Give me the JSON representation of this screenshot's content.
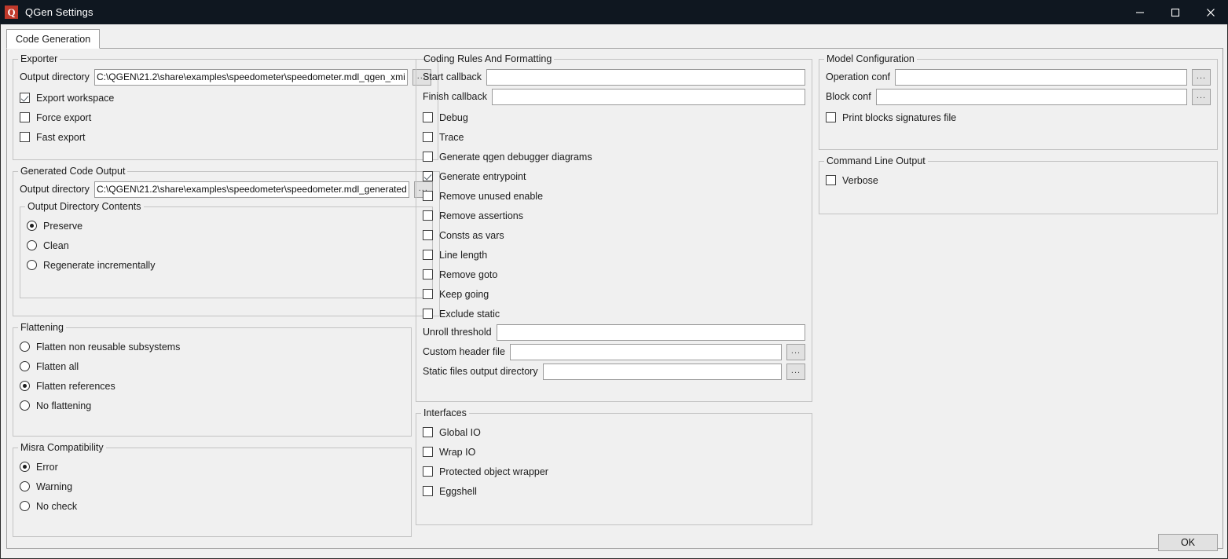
{
  "window": {
    "title": "QGen Settings",
    "logo_letter": "Q",
    "logo_color": "#c0392b",
    "titlebar_color": "#0f1720",
    "minimize_icon": "minimize-icon",
    "maximize_icon": "maximize-icon",
    "close_icon": "close-icon"
  },
  "tabs": [
    {
      "label": "Code Generation",
      "selected": true
    }
  ],
  "groups": {
    "exporter": {
      "title": "Exporter",
      "output_directory_label": "Output directory",
      "output_directory_value": "C:\\QGEN\\21.2\\share\\examples\\speedometer\\speedometer.mdl_qgen_xmi",
      "browse_label": "...",
      "checkboxes": [
        {
          "label": "Export workspace",
          "checked": true
        },
        {
          "label": "Force export",
          "checked": false
        },
        {
          "label": "Fast export",
          "checked": false
        }
      ]
    },
    "generated_code_output": {
      "title": "Generated Code Output",
      "output_directory_label": "Output directory",
      "output_directory_value": "C:\\QGEN\\21.2\\share\\examples\\speedometer\\speedometer.mdl_generated",
      "browse_label": "...",
      "output_directory_contents": {
        "title": "Output Directory Contents",
        "options": [
          {
            "label": "Preserve",
            "checked": true
          },
          {
            "label": "Clean",
            "checked": false
          },
          {
            "label": "Regenerate incrementally",
            "checked": false
          }
        ]
      }
    },
    "flattening": {
      "title": "Flattening",
      "options": [
        {
          "label": "Flatten non reusable subsystems",
          "checked": false
        },
        {
          "label": "Flatten all",
          "checked": false
        },
        {
          "label": "Flatten references",
          "checked": true
        },
        {
          "label": "No flattening",
          "checked": false
        }
      ]
    },
    "misra": {
      "title": "Misra Compatibility",
      "options": [
        {
          "label": "Error",
          "checked": true
        },
        {
          "label": "Warning",
          "checked": false
        },
        {
          "label": "No check",
          "checked": false
        }
      ]
    },
    "coding_rules": {
      "title": "Coding Rules And Formatting",
      "start_callback_label": "Start callback",
      "start_callback_value": "",
      "finish_callback_label": "Finish callback",
      "finish_callback_value": "",
      "checkboxes": [
        {
          "label": "Debug",
          "checked": false
        },
        {
          "label": "Trace",
          "checked": false
        },
        {
          "label": "Generate qgen debugger diagrams",
          "checked": false
        },
        {
          "label": "Generate entrypoint",
          "checked": true
        },
        {
          "label": "Remove unused enable",
          "checked": false
        },
        {
          "label": "Remove assertions",
          "checked": false
        },
        {
          "label": "Consts as vars",
          "checked": false
        },
        {
          "label": "Line length",
          "checked": false
        },
        {
          "label": "Remove goto",
          "checked": false
        },
        {
          "label": "Keep going",
          "checked": false
        },
        {
          "label": "Exclude static",
          "checked": false
        }
      ],
      "unroll_threshold_label": "Unroll threshold",
      "unroll_threshold_value": "",
      "custom_header_file_label": "Custom header file",
      "custom_header_file_value": "",
      "static_files_output_directory_label": "Static files output directory",
      "static_files_output_directory_value": "",
      "browse_label": "..."
    },
    "interfaces": {
      "title": "Interfaces",
      "checkboxes": [
        {
          "label": "Global IO",
          "checked": false
        },
        {
          "label": "Wrap IO",
          "checked": false
        },
        {
          "label": "Protected object wrapper",
          "checked": false
        },
        {
          "label": "Eggshell",
          "checked": false
        }
      ]
    },
    "model_configuration": {
      "title": "Model Configuration",
      "operation_conf_label": "Operation conf",
      "operation_conf_value": "",
      "block_conf_label": "Block conf",
      "block_conf_value": "",
      "browse_label": "...",
      "checkboxes": [
        {
          "label": "Print blocks signatures file",
          "checked": false
        }
      ]
    },
    "command_line_output": {
      "title": "Command Line Output",
      "checkboxes": [
        {
          "label": "Verbose",
          "checked": false
        }
      ]
    }
  },
  "footer": {
    "ok_label": "OK"
  }
}
